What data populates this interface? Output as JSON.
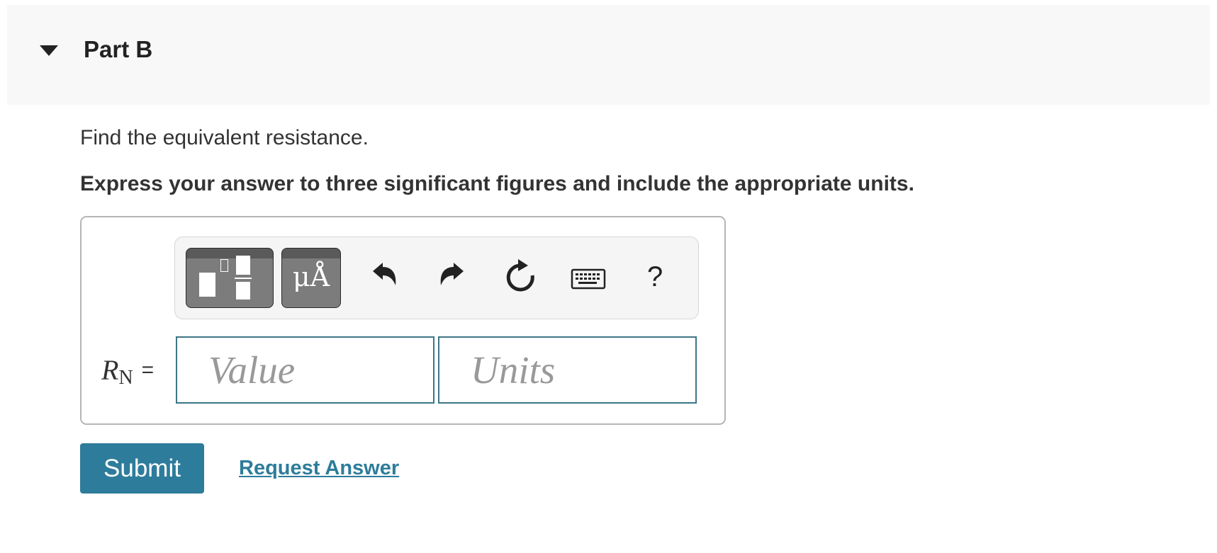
{
  "part": {
    "title": "Part B"
  },
  "question": {
    "prompt": "Find the equivalent resistance.",
    "instructions": "Express your answer to three significant figures and include the appropriate units."
  },
  "answer": {
    "variable": "R",
    "subscript": "N",
    "equals": "=",
    "value_placeholder": "Value",
    "units_placeholder": "Units",
    "value": "",
    "units": ""
  },
  "toolbar": {
    "units_button_label": "μÅ",
    "help_label": "?",
    "icons": [
      "fraction-template-icon",
      "units-icon",
      "undo-icon",
      "redo-icon",
      "reset-icon",
      "keyboard-icon",
      "help-icon"
    ]
  },
  "actions": {
    "submit_label": "Submit",
    "request_answer_label": "Request Answer"
  },
  "colors": {
    "accent": "#2e7c9b",
    "input_border": "#3c7687",
    "header_bg": "#f8f8f8",
    "toolbar_button": "#7c7c7c"
  }
}
